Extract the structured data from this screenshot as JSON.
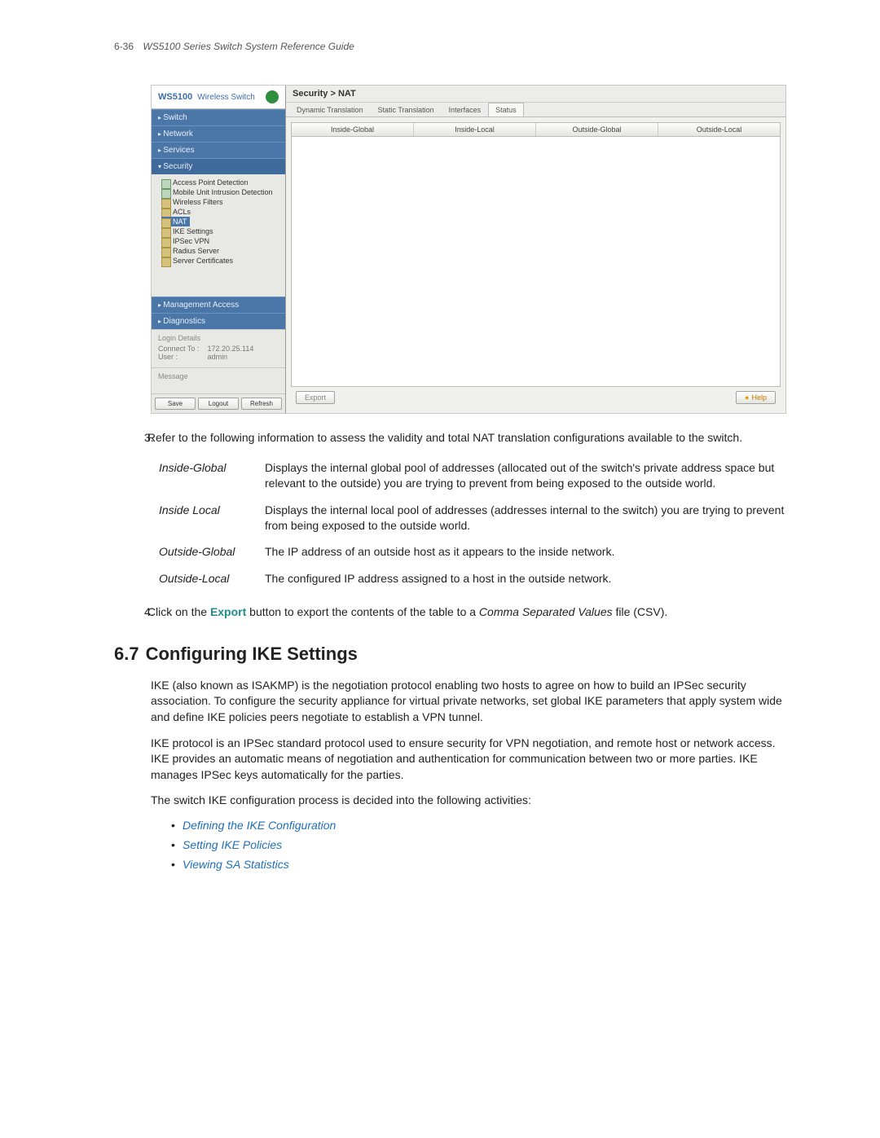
{
  "page_header": {
    "num": "6-36",
    "title": "WS5100 Series Switch System Reference Guide"
  },
  "screenshot": {
    "brand": {
      "product": "WS5100",
      "sub": "Wireless Switch"
    },
    "nav": {
      "switch": "Switch",
      "network": "Network",
      "services": "Services",
      "security": "Security",
      "management": "Management Access",
      "diagnostics": "Diagnostics"
    },
    "tree": {
      "apd": "Access Point Detection",
      "muid": "Mobile Unit Intrusion Detection",
      "wf": "Wireless Filters",
      "acls": "ACLs",
      "nat": "NAT",
      "ike": "IKE Settings",
      "ipsec": "IPSec VPN",
      "radius": "Radius Server",
      "certs": "Server Certificates"
    },
    "login": {
      "title": "Login Details",
      "connect_lbl": "Connect To :",
      "connect_val": "172.20.25.114",
      "user_lbl": "User :",
      "user_val": "admin"
    },
    "message": {
      "title": "Message"
    },
    "buttons": {
      "save": "Save",
      "logout": "Logout",
      "refresh": "Refresh"
    },
    "breadcrumb": "Security > NAT",
    "tabs": {
      "dyn": "Dynamic Translation",
      "stat": "Static Translation",
      "int": "Interfaces",
      "status": "Status"
    },
    "cols": {
      "ig": "Inside-Global",
      "il": "Inside-Local",
      "og": "Outside-Global",
      "ol": "Outside-Local"
    },
    "export": "Export",
    "help": "Help"
  },
  "step3": "Refer to the following information to assess the validity and total NAT translation configurations available to the switch.",
  "defs": {
    "ig": {
      "term": "Inside-Global",
      "desc": "Displays the internal global pool of addresses (allocated out of the switch's private address space but relevant to the outside) you are trying to prevent from being exposed to the outside world."
    },
    "il": {
      "term": "Inside Local",
      "desc": "Displays the internal local pool of addresses (addresses internal to the switch) you are trying to prevent from being exposed to the outside world."
    },
    "og": {
      "term": "Outside-Global",
      "desc": "The IP address of an outside host as it appears to the inside network."
    },
    "ol": {
      "term": "Outside-Local",
      "desc": "The configured IP address assigned to a host in the outside network."
    }
  },
  "step4": {
    "pre": "Click on the ",
    "export": "Export",
    "mid": " button to export the contents of the table to a ",
    "csv": "Comma Separated Values",
    "post": " file (CSV)."
  },
  "section": {
    "num": "6.7",
    "title": "Configuring IKE Settings"
  },
  "para1": "IKE (also known as ISAKMP) is the negotiation protocol enabling two hosts to agree on how to build an IPSec security association. To configure the security appliance for virtual private networks, set global IKE parameters that apply system wide and define IKE policies peers negotiate to establish a VPN tunnel.",
  "para2": "IKE protocol is an IPSec standard protocol used to ensure security for VPN negotiation, and remote host or network access. IKE provides an automatic means of negotiation and authentication for communication between two or more parties. IKE manages IPSec keys automatically for the parties.",
  "para3": "The switch IKE configuration process is decided into the following activities:",
  "links": {
    "a": "Defining the IKE Configuration",
    "b": "Setting IKE Policies",
    "c": "Viewing SA Statistics"
  }
}
